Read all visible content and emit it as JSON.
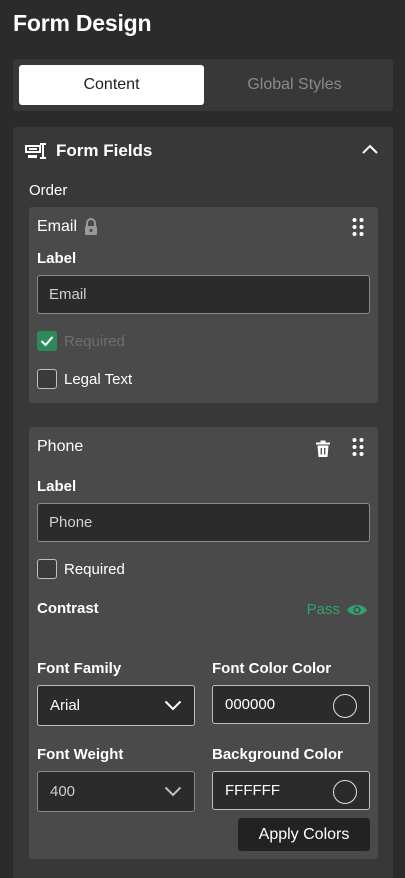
{
  "page": {
    "title": "Form Design"
  },
  "tabs": [
    {
      "label": "Content",
      "active": true
    },
    {
      "label": "Global Styles",
      "active": false
    }
  ],
  "panel": {
    "title": "Form Fields",
    "icon": "form-fields-icon",
    "order_label": "Order"
  },
  "fields": [
    {
      "name": "Email",
      "locked": true,
      "label_heading": "Label",
      "label_value": "Email",
      "required": {
        "label": "Required",
        "checked": true,
        "disabled": true
      },
      "legal_text": {
        "label": "Legal Text",
        "checked": false
      }
    },
    {
      "name": "Phone",
      "deletable": true,
      "label_heading": "Label",
      "label_value": "Phone",
      "required": {
        "label": "Required",
        "checked": false
      },
      "contrast": {
        "label": "Contrast",
        "status": "Pass",
        "status_color": "#2fa56d"
      },
      "font_family": {
        "label": "Font Family",
        "value": "Arial"
      },
      "font_color": {
        "label": "Font Color Color",
        "value": "000000",
        "swatch": "#000000"
      },
      "font_weight": {
        "label": "Font Weight",
        "value": "400"
      },
      "background_color": {
        "label": "Background Color",
        "value": "FFFFFF",
        "swatch": "#FFFFFF"
      },
      "apply_button": "Apply Colors"
    }
  ],
  "colors": {
    "accent_green": "#2e8a5b",
    "background": "#2b2b2b",
    "panel": "#383838",
    "card": "#4a4a4a"
  }
}
